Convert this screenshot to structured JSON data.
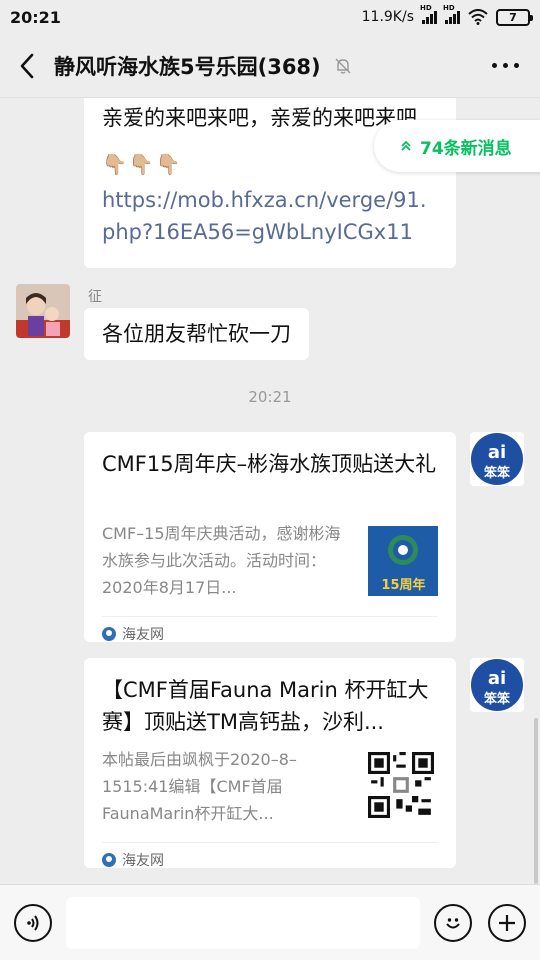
{
  "status_bar": {
    "time": "20:21",
    "net_speed": "11.9K/s",
    "signal_tag_1": "HD",
    "signal_tag_2": "HD",
    "battery": "7"
  },
  "header": {
    "title": "静风听海水族5号乐园(368)",
    "muted": true
  },
  "new_messages_label": "74条新消息",
  "messages": [
    {
      "type": "text",
      "text_line1": "亲爱的来吧来吧，亲爱的来吧来吧",
      "emoji": "👇🏼👇🏼👇🏼",
      "link": "https://mob.hfxza.cn/verge/91.php?16EA56=gWbLnyICGx11"
    },
    {
      "type": "text",
      "sender": "征",
      "text": "各位朋友帮忙砍一刀"
    },
    {
      "type": "timestamp",
      "text": "20:21"
    },
    {
      "type": "link_card",
      "title": "CMF15周年庆–彬海水族顶贴送大礼",
      "desc": "CMF–15周年庆典活动，感谢彬海水族参与此次活动。活动时间：2020年8月17日...",
      "thumb_text": "15周年",
      "source": "海友网"
    },
    {
      "type": "link_card",
      "title": "【CMF首届Fauna Marin 杯开缸大赛】顶贴送TM高钙盐，沙利...",
      "desc": "本帖最后由飒枫于2020–8–1515:41编辑【CMF首届FaunaMarin杯开缸大...",
      "source": "海友网"
    }
  ],
  "avatars": {
    "ai_badge_top": "ai",
    "ai_badge_bottom": "笨笨"
  },
  "colors": {
    "accent_green": "#07c160",
    "link_blue": "#576b95",
    "bg": "#ededed"
  },
  "icons": {
    "back": "back-arrow-icon",
    "mute": "bell-muted-icon",
    "more": "more-dots-icon",
    "voice": "voice-icon",
    "emoji": "emoji-icon",
    "plus": "plus-icon"
  }
}
